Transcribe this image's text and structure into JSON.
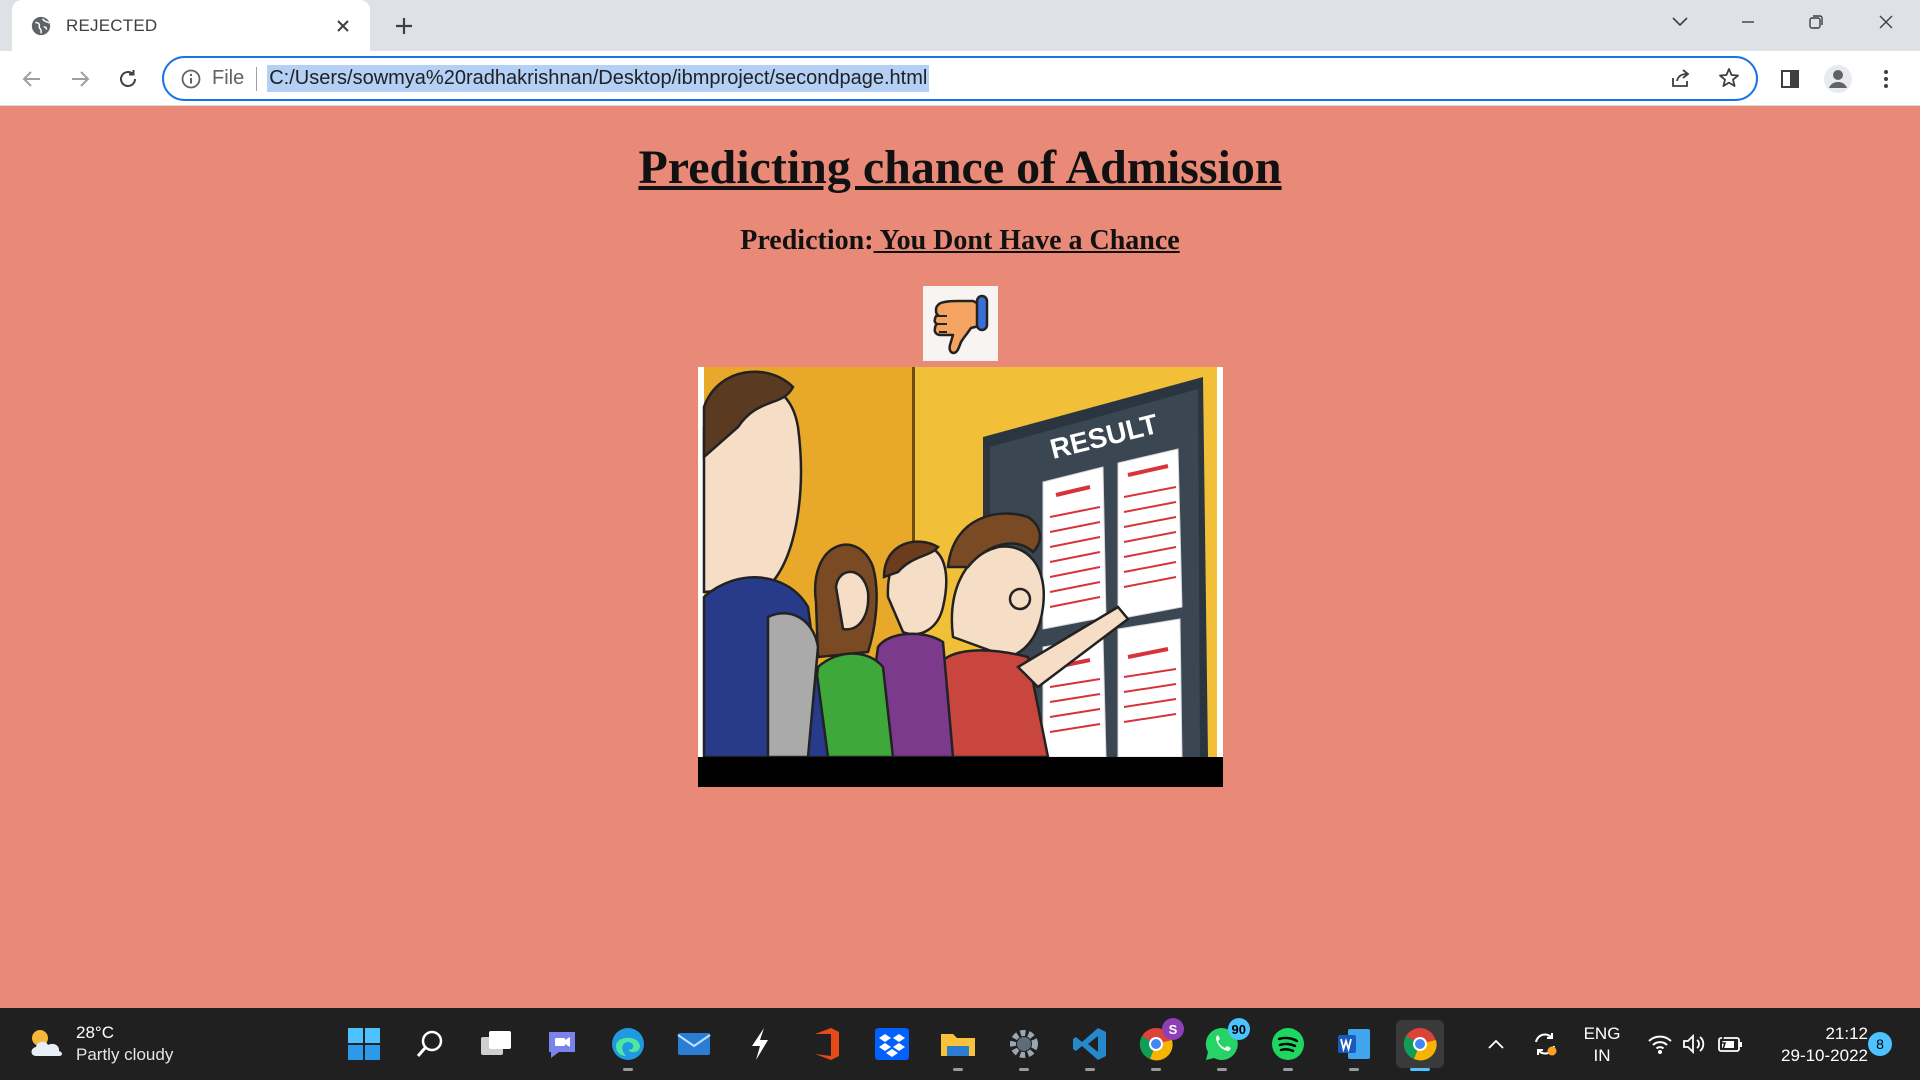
{
  "browser": {
    "tab_title": "REJECTED",
    "scheme_label": "File",
    "url": "C:/Users/sowmya%20radhakrishnan/Desktop/ibmproject/secondpage.html"
  },
  "page": {
    "title": "Predicting chance of Admission",
    "prediction_label": "Prediction:",
    "prediction_result": " You Dont Have a Chance",
    "illustration_sign": "RESULT",
    "thumb_icon": "thumbs-down-icon"
  },
  "taskbar": {
    "weather_temp": "28°C",
    "weather_condition": "Partly cloudy",
    "whatsapp_badge": "90",
    "chrome_profile_badge": "S",
    "lang_primary": "ENG",
    "lang_secondary": "IN",
    "time": "21:12",
    "date": "29-10-2022",
    "notification_count": "8"
  },
  "colors": {
    "page_background": "#e98a78",
    "omnibox_focus": "#1a73e8",
    "url_selection": "#b4d0f4"
  }
}
